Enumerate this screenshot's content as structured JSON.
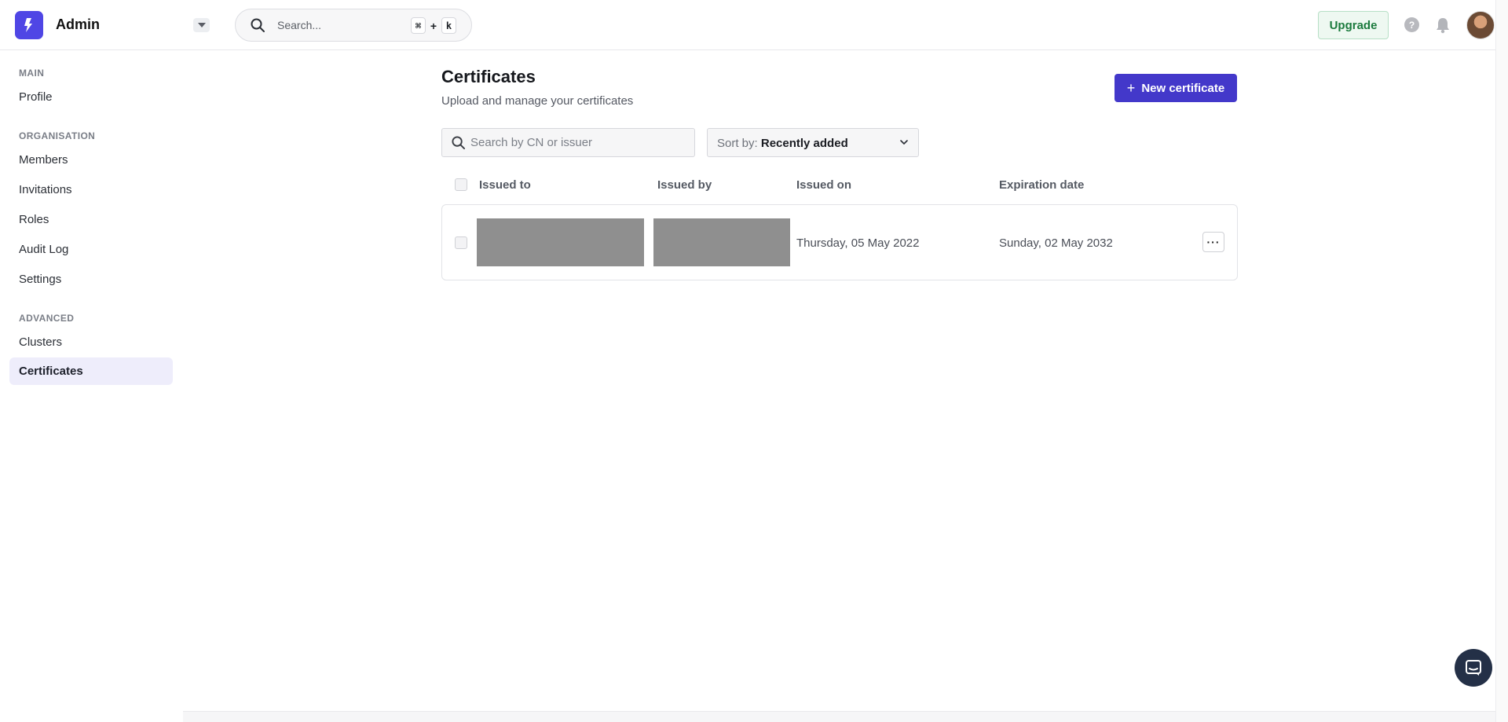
{
  "header": {
    "app_title": "Admin",
    "search_placeholder": "Search...",
    "shortcut_key1": "⌘",
    "shortcut_plus": "+",
    "shortcut_key2": "k",
    "upgrade_label": "Upgrade",
    "help_glyph": "?"
  },
  "sidebar": {
    "sections": [
      {
        "title": "MAIN",
        "items": [
          {
            "label": "Profile"
          }
        ]
      },
      {
        "title": "ORGANISATION",
        "items": [
          {
            "label": "Members"
          },
          {
            "label": "Invitations"
          },
          {
            "label": "Roles"
          },
          {
            "label": "Audit Log"
          },
          {
            "label": "Settings"
          }
        ]
      },
      {
        "title": "ADVANCED",
        "items": [
          {
            "label": "Clusters"
          },
          {
            "label": "Certificates",
            "active": true
          }
        ]
      }
    ]
  },
  "main": {
    "title": "Certificates",
    "subtitle": "Upload and manage your certificates",
    "new_button_icon": "+",
    "new_button_label": "New certificate",
    "filter_placeholder": "Search by CN or issuer",
    "sort_label": "Sort by: ",
    "sort_value": "Recently added",
    "columns": [
      "Issued to",
      "Issued by",
      "Issued on",
      "Expiration date"
    ],
    "rows": [
      {
        "issued_to": "",
        "issued_by": "",
        "issued_on": "Thursday, 05 May 2022",
        "expiration": "Sunday, 02 May 2032",
        "more_label": "···"
      }
    ]
  },
  "colors": {
    "accent": "#4338ca",
    "active_nav_bg": "#eeedfb",
    "upgrade_green": "#1b7a3d"
  },
  "icons": {
    "logo": "app-logo",
    "search": "search-icon",
    "dropdown": "caret-down-icon",
    "help": "help-icon",
    "bell": "bell-icon",
    "chevron": "chevron-down-icon",
    "chat": "chat-icon"
  }
}
